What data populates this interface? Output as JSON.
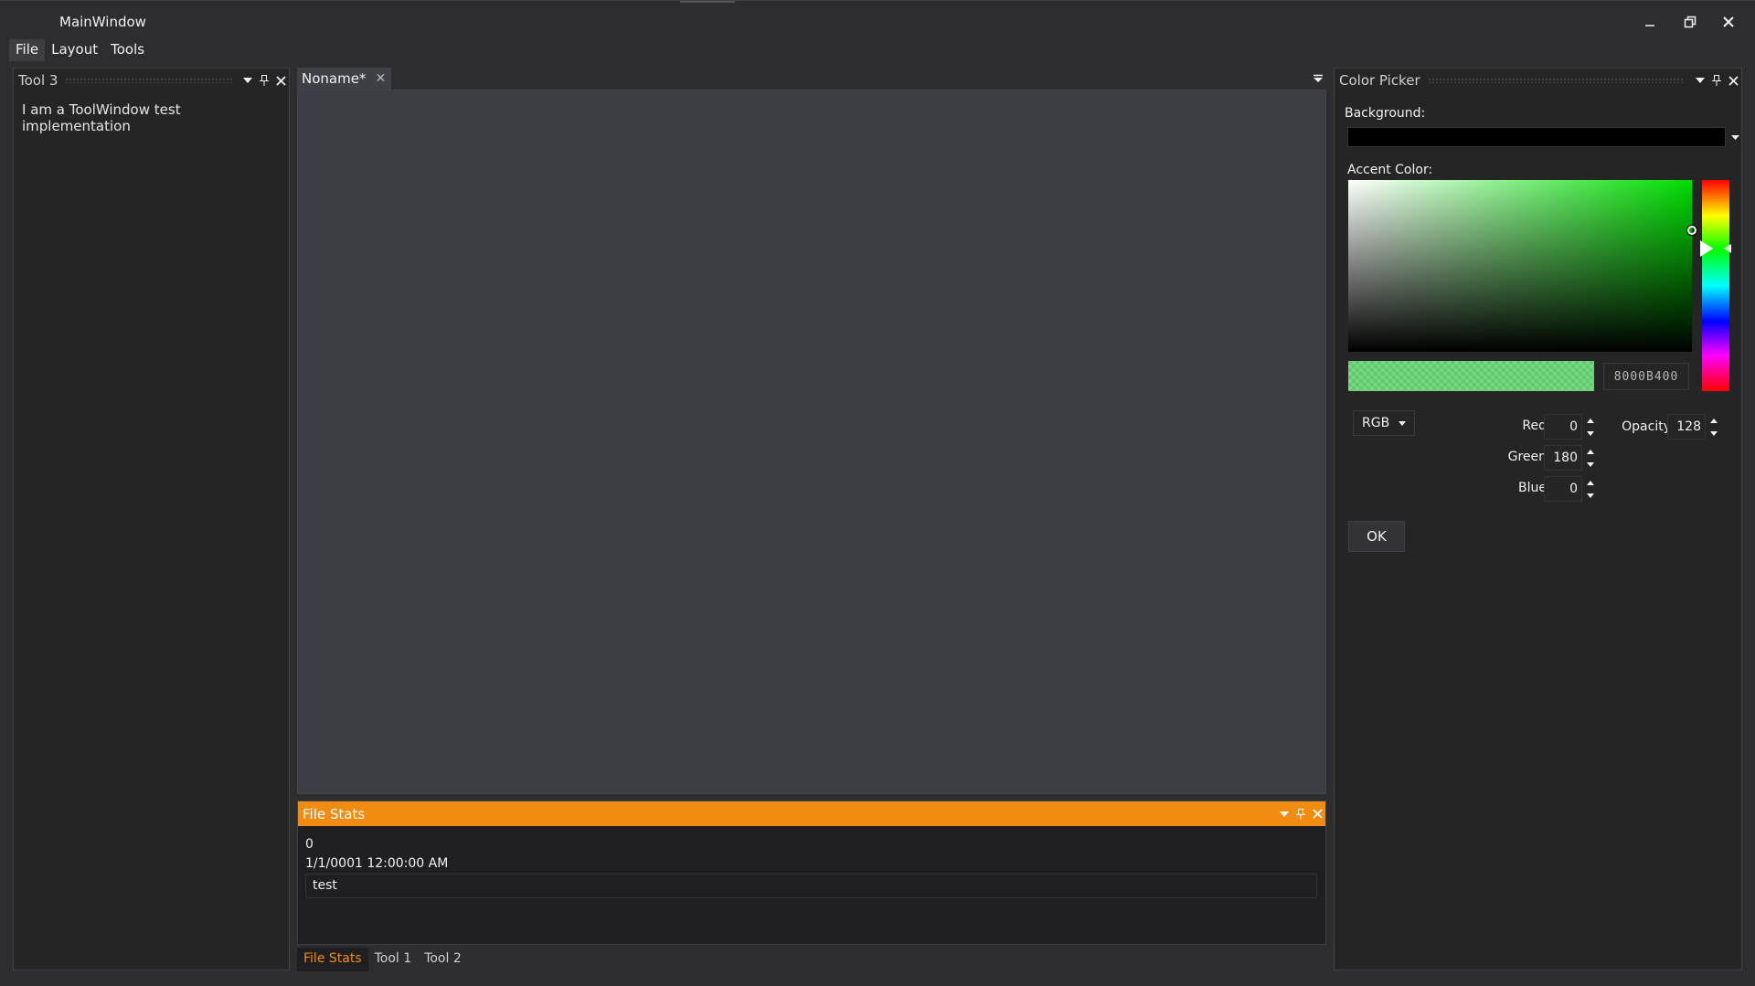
{
  "window": {
    "title": "MainWindow",
    "minimize_icon": "minimize-icon",
    "restore_icon": "restore-icon",
    "close_icon": "close-icon"
  },
  "menu": {
    "items": [
      {
        "label": "File"
      },
      {
        "label": "Layout"
      },
      {
        "label": "Tools"
      }
    ]
  },
  "tool3": {
    "title": "Tool 3",
    "content": "I am a ToolWindow test implementation"
  },
  "document": {
    "tab_label": "Noname*",
    "tab_close": "✕"
  },
  "file_stats": {
    "title": "File Stats",
    "value1": "0",
    "value2": "1/1/0001 12:00:00 AM",
    "textbox_value": "test",
    "accent": "#f08c12"
  },
  "bottom_tabs": [
    {
      "label": "File Stats",
      "active": true
    },
    {
      "label": "Tool 1",
      "active": false
    },
    {
      "label": "Tool 2",
      "active": false
    }
  ],
  "color_picker": {
    "title": "Color Picker",
    "background_label": "Background:",
    "background_value": "#000000",
    "accent_label": "Accent Color:",
    "hex_value": "8000B400",
    "mode": "RGB",
    "channels": {
      "red_label": "Red",
      "red_value": "0",
      "green_label": "Green",
      "green_value": "180",
      "blue_label": "Blue",
      "blue_value": "0",
      "opacity_label": "Opacity",
      "opacity_value": "128"
    },
    "ok_label": "OK"
  }
}
